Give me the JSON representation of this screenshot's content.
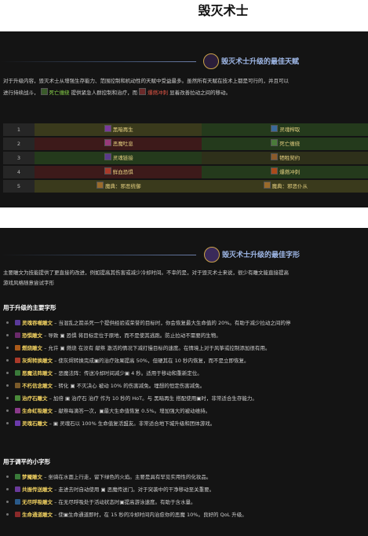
{
  "page_title": "毁灭术士",
  "section_talents": {
    "title": "毁灭术士升级的最佳天赋",
    "para_line1": "对于升级内容，毁灭术士从增强生存能力、范围控制和机动性的天赋中受益最多。虽然所有天赋在技术上都是可行的，并且可以",
    "para_line2_pre": "进行持续战斗，",
    "para_line2_hl1": "死亡缠绕",
    "para_line2_mid": "提供紧急人群控制和治疗，而",
    "para_line2_hl2": "爆燃冲刺",
    "para_line2_post": "显着改善拉动之间的移动。",
    "rows": [
      {
        "num": "1",
        "left": "黑暗再生",
        "right": "灵魂榨取"
      },
      {
        "num": "2",
        "left": "恶魔吐息",
        "right": "死亡缠绕"
      },
      {
        "num": "3",
        "left": "灵魂链接",
        "right": "牺牲契约"
      },
      {
        "num": "4",
        "left": "鲜血恐惧",
        "right": "爆燃冲刺"
      },
      {
        "num": "5",
        "left": "魔典：邪恶统御",
        "right": "魔典：邪恶仆从"
      }
    ]
  },
  "section_glyphs": {
    "title": "毁灭术士升级的最佳字形",
    "para_line1": "主要雕文为技能提供了更直接的改进，例如提高其伤害或减少冷却时间。不幸的是，对于毁灭术士来说，很少有雕文能直接提高",
    "para_line2": "游戏风格随意尝试字形",
    "major_heading": "用于升级的主要字形",
    "major": [
      {
        "name": "灵魂吞噬雕文",
        "text": " – 当混乱之箭杀死一个提供经验或荣誉的目标时，你会恢复最大生命值的 20%。有助于减少拉动之间的停"
      },
      {
        "name": "恐惧雕文",
        "text": " – 导致 ▣ 恐惧 将目标定位于原地，而不是使其逃跑。防止拉动不需要的生物。"
      },
      {
        "name": "燃烧雕文",
        "text": " – 允许 ▣ 燃烧 在没有 献祭 激活的情况下减打慢目标的速度。在情境上对于风筝或控制添加很有用。"
      },
      {
        "name": "灰烬转换雕文",
        "text": " – 使灰烬转换完成▣的治疗效果提高 50%，但硬其在 10 秒内恢复，而不是立即恢复。"
      },
      {
        "name": "恶魔法阵雕文",
        "text": " – 恶魔法阵：传送冷却时间减少▣ 4 秒。适用于移动和重新定位。"
      },
      {
        "name": "不朽信念雕文",
        "text": " – 转化 ▣ 不灭决心 被动 10% 的伤害减免。埋想的恒定伤害减免。"
      },
      {
        "name": "治疗石雕文",
        "text": " – 加倍 ▣ 治疗石 治疗 作为 10 秒的 HoT。与 黑暗再生 搭配使用▣时，非常适合生存能力。"
      },
      {
        "name": "生命虹吸雕文",
        "text": " – 献祭每滴答一次，▣最大生命值恢复 0.5%。增加强大的被动维持。"
      },
      {
        "name": "灵魂石雕文",
        "text": " – ▣ 灵魂石以 100% 生命值复活盟友。非常适合地下城升级和团体游戏。"
      }
    ],
    "minor_heading": "用于调平的小字形",
    "minor": [
      {
        "name": "梦魇雕文",
        "text": " – 坐骑在水面上行走，留下绿色的火焰。主要是具有罕见实用性的化妆品。"
      },
      {
        "name": "共振传送雕文",
        "text": " – 走进去时自动使用 ▣ 恶魔传送门。对于突袭中的干净移动至关重要。"
      },
      {
        "name": "无尽呼吸雕文",
        "text": " – 在无尽呼吸处于活动状态时▣提高游泳速度。有助于含水量。"
      },
      {
        "name": "生命通道雕文",
        "text": " – 使▣生命通道即时，在 15 秒的冷却时间内治愈你的恶魔 10%。良好的 QoL 升级。"
      }
    ]
  },
  "colors": {
    "accent_title": "#9fb8e8",
    "talent_text": "#e5d080",
    "glyph_name": "#f0d060",
    "green_highlight": "#8bd64a",
    "red_highlight": "#e05545"
  }
}
